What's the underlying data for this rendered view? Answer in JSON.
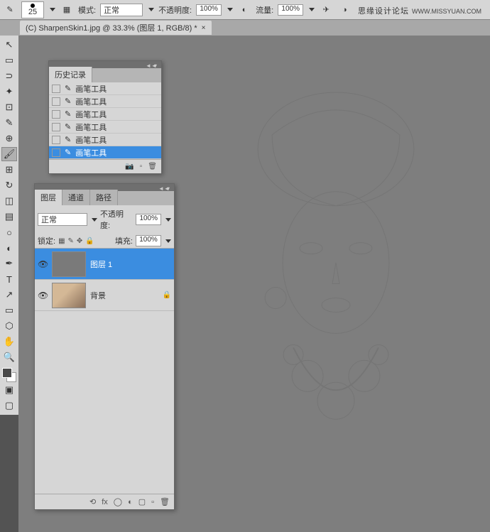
{
  "watermark": {
    "title": "思缘设计论坛",
    "url": "WWW.MISSYUAN.COM"
  },
  "options": {
    "brush_size": "25",
    "mode_label": "模式:",
    "mode_value": "正常",
    "opacity_label": "不透明度:",
    "opacity_value": "100%",
    "flow_label": "流量:",
    "flow_value": "100%"
  },
  "tab": {
    "title": "(C) SharpenSkin1.jpg @ 33.3% (图层 1, RGB/8) *"
  },
  "history": {
    "title": "历史记录",
    "items": [
      "画笔工具",
      "画笔工具",
      "画笔工具",
      "画笔工具",
      "画笔工具",
      "画笔工具"
    ],
    "selected": 5
  },
  "layers": {
    "tabs": [
      "图层",
      "通道",
      "路径"
    ],
    "blend": "正常",
    "opacity_label": "不透明度:",
    "opacity_value": "100%",
    "lock_label": "锁定:",
    "fill_label": "填充:",
    "fill_value": "100%",
    "items": [
      {
        "name": "图层 1",
        "selected": true,
        "locked": false,
        "bg": false
      },
      {
        "name": "背景",
        "selected": false,
        "locked": true,
        "bg": true
      }
    ]
  }
}
